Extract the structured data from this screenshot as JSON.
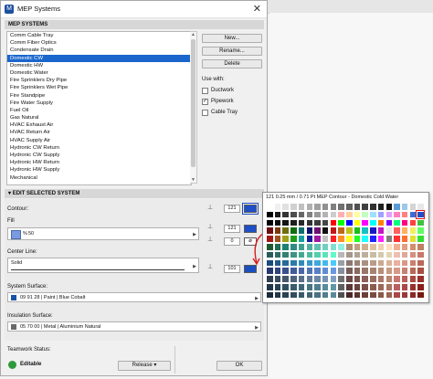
{
  "window": {
    "title": "MEP Systems",
    "close_glyph": "✕",
    "app_icon_glyph": "M"
  },
  "systems_header": "MEP SYSTEMS",
  "systems": [
    "Comm Cable Tray",
    "Comm Fiber Optics",
    "Condensate Drain",
    "Domestic CW",
    "Domestic HW",
    "Domestic Water",
    "Fire Sprinklers Dry Pipe",
    "Fire Sprinklers Wet Pipe",
    "Fire Standpipe",
    "Fire Water Supply",
    "Fuel Oil",
    "Gas Natural",
    "HVAC Exhaust Air",
    "HVAC Return Air",
    "HVAC Supply Air",
    "Hydronic CW Return",
    "Hydronic CW Supply",
    "Hydronic HW Return",
    "Hydronic HW Supply",
    "Mechanical"
  ],
  "selected_index": 3,
  "buttons": {
    "new": "New...",
    "rename": "Rename...",
    "delete": "Delete",
    "release": "Release",
    "ok": "OK"
  },
  "use_with": {
    "label": "Use with:",
    "options": [
      {
        "label": "Ductwork",
        "checked": false
      },
      {
        "label": "Pipework",
        "checked": true
      },
      {
        "label": "Cable Tray",
        "checked": false
      }
    ]
  },
  "edit_header": "EDIT SELECTED SYSTEM",
  "contour": {
    "label": "Contour:",
    "pen": "121",
    "color": "#1f4fc8"
  },
  "fill": {
    "label": "Fill",
    "pattern_label": "50",
    "pct_symbol": "%",
    "swatch_color": "#7a9be0",
    "pen": "121",
    "pen_color": "#1f4fc8",
    "bg_pen": "0"
  },
  "center_line": {
    "label": "Center Line:",
    "value": "Solid",
    "pen": "101",
    "pen_color": "#1b4fc0"
  },
  "system_surface": {
    "label": "System Surface:",
    "value": "09 91 28 | Paint | Blue Cobalt",
    "color": "#1b53a8"
  },
  "insulation_surface": {
    "label": "Insulation Surface:",
    "value": "05 70 00 | Metal | Aluminium Natural",
    "color": "#6b6b6b"
  },
  "teamwork": {
    "label": "Teamwork Status:",
    "status": "Editable",
    "status_color": "#2e9a3a"
  },
  "pen_popup": {
    "title": "121  0.25 mm / 0.71 Pt MEP Contour - Domestic Cold Water",
    "selected_row": 1,
    "selected_col": 19,
    "rows": [
      [
        "#ffffff",
        "#f0f0f0",
        "#e0e0e0",
        "#d0d0d0",
        "#c0c0c0",
        "#b0b0b0",
        "#a0a0a0",
        "#909090",
        "#808080",
        "#707070",
        "#606060",
        "#505050",
        "#404040",
        "#303030",
        "#202020",
        "#101010",
        "#5b9bd5",
        "#9ec8e8",
        "#d4d4d4",
        "#e8e8e8"
      ],
      [
        "#000000",
        "#1a1a1a",
        "#333333",
        "#4d4d4d",
        "#666666",
        "#808080",
        "#999999",
        "#b3b3b3",
        "#cccccc",
        "#ffb0b0",
        "#ffd0a0",
        "#ffffa0",
        "#c0ffc0",
        "#a0e0ff",
        "#a0a0ff",
        "#e0a0ff",
        "#ff80c0",
        "#ff8080",
        "#3a6fd8",
        "#1f4fc8"
      ],
      [
        "#000000",
        "#0a0a0a",
        "#141414",
        "#1e1e1e",
        "#282828",
        "#323232",
        "#3c3c3c",
        "#464646",
        "#ff0000",
        "#00ff00",
        "#0000ff",
        "#ffff00",
        "#ff00ff",
        "#00ffff",
        "#ff8000",
        "#8000ff",
        "#00ff80",
        "#ff0080",
        "#ff4040",
        "#40c040"
      ],
      [
        "#6e1010",
        "#7a3a10",
        "#6e6e10",
        "#106e10",
        "#106e6e",
        "#10106e",
        "#6e106e",
        "#101010",
        "#c01818",
        "#c06818",
        "#c0c018",
        "#18c018",
        "#18c0c0",
        "#1818c0",
        "#c018c0",
        "#e8e8e8",
        "#ff6060",
        "#ffb060",
        "#f0f060",
        "#60ff60"
      ],
      [
        "#a01818",
        "#a05018",
        "#a0a018",
        "#18a018",
        "#18a0a0",
        "#1818a0",
        "#a018a0",
        "#c0c0c0",
        "#ff2020",
        "#ff9020",
        "#ffff20",
        "#20ff20",
        "#20ffff",
        "#2020ff",
        "#ff20ff",
        "#808080",
        "#ff3030",
        "#ff7030",
        "#e0e030",
        "#30e030"
      ],
      [
        "#1e5a30",
        "#1e6e50",
        "#1e8070",
        "#308c80",
        "#40a090",
        "#50b0a0",
        "#60c0b0",
        "#70d0c0",
        "#80e0d0",
        "#90f0e0",
        "#b09070",
        "#c0a080",
        "#d0b090",
        "#e0c0a0",
        "#f0d0b0",
        "#ffe0c0",
        "#f0b090",
        "#e0a080",
        "#d09070",
        "#c08060"
      ],
      [
        "#285c58",
        "#2f6c66",
        "#368074",
        "#3d9482",
        "#44a890",
        "#4bbc9e",
        "#52d0ac",
        "#59e4ba",
        "#60f8c8",
        "#b8b8b8",
        "#a4988c",
        "#b0a494",
        "#bcb09c",
        "#c8bca4",
        "#d4c8ac",
        "#e0d4b4",
        "#ecbfb0",
        "#e0a898",
        "#d49080",
        "#c87868"
      ],
      [
        "#1a4a7a",
        "#205a8a",
        "#266a9a",
        "#2c7aaa",
        "#328aba",
        "#389aca",
        "#3eaada",
        "#44baea",
        "#4acafa",
        "#9aa0a6",
        "#8a7870",
        "#9a8478",
        "#aa9080",
        "#ba9c88",
        "#caa890",
        "#dab498",
        "#eab0a0",
        "#da9888",
        "#ca8070",
        "#ba6858"
      ],
      [
        "#283870",
        "#30447e",
        "#38508c",
        "#405c9a",
        "#4868a8",
        "#5074b6",
        "#5880c4",
        "#608cd2",
        "#6898e0",
        "#8890a0",
        "#785e58",
        "#886a60",
        "#987668",
        "#a88270",
        "#b88e78",
        "#c89a80",
        "#d89888",
        "#c88070",
        "#b86858",
        "#a85040"
      ],
      [
        "#304050",
        "#3a4c5e",
        "#44586c",
        "#4e647a",
        "#587088",
        "#627c96",
        "#6c88a4",
        "#7694b2",
        "#80a0c0",
        "#707070",
        "#6a4848",
        "#7a5450",
        "#8a6058",
        "#9a6c60",
        "#aa7868",
        "#ba8470",
        "#c87870",
        "#b86058",
        "#a84840",
        "#983028"
      ],
      [
        "#203848",
        "#284454",
        "#305060",
        "#385c6c",
        "#406878",
        "#487484",
        "#508090",
        "#588c9c",
        "#6098a8",
        "#606060",
        "#5a3838",
        "#6a4440",
        "#7a5048",
        "#8a5c50",
        "#9a6858",
        "#aa7460",
        "#b86060",
        "#a84848",
        "#983030",
        "#882018"
      ],
      [
        "#1a2a3a",
        "#223646",
        "#2a4252",
        "#324e5e",
        "#3a5a6a",
        "#426676",
        "#4a7282",
        "#527e8e",
        "#5a8a9a",
        "#505050",
        "#4a2828",
        "#5a3430",
        "#6a4038",
        "#7a4c40",
        "#8a5848",
        "#9a6450",
        "#a84848",
        "#983838",
        "#882828",
        "#781810"
      ]
    ]
  }
}
